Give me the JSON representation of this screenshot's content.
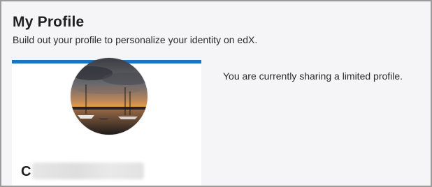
{
  "header": {
    "title": "My Profile",
    "subtitle": "Build out your profile to personalize your identity on edX."
  },
  "profile": {
    "username_initial": "C",
    "avatar_icon": "profile-photo",
    "accent_color": "#1e73be"
  },
  "sharing": {
    "status_text": "You are currently sharing a limited profile."
  }
}
